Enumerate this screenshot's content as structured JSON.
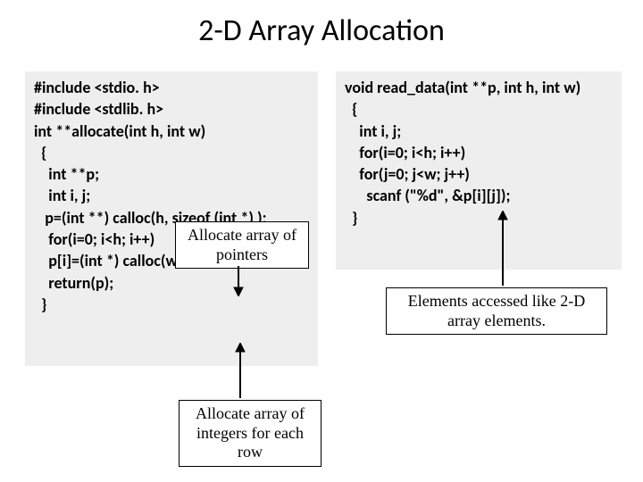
{
  "title": "2-D Array Allocation",
  "left": {
    "l1": "#include <stdio. h>",
    "l2": "#include <stdlib. h>",
    "l3": "",
    "l4": "int **allocate(int h, int w)",
    "l5": "  {",
    "l6": "    int **p;",
    "l7": "    int i, j;",
    "l8": "",
    "l9": "   p=(int **) calloc(h, sizeof (int *) );",
    "l10": "    for(i=0; i<h; i++)",
    "l11": "    p[i]=(int *) calloc(w, sizeof (int));",
    "l12": "    return(p);",
    "l13": "  }"
  },
  "right": {
    "l1": "void read_data(int **p, int h, int w)",
    "l2": "  {",
    "l3": "    int i, j;",
    "l4": "    for(i=0; i<h; i++)",
    "l5": "    for(j=0; j<w; j++)",
    "l6": "      scanf (\"%d\", &p[i][j]);",
    "l7": "  }"
  },
  "callout1": "Allocate array of pointers",
  "callout2": "Allocate array of integers for each row",
  "callout3": "Elements accessed like 2-D array elements."
}
